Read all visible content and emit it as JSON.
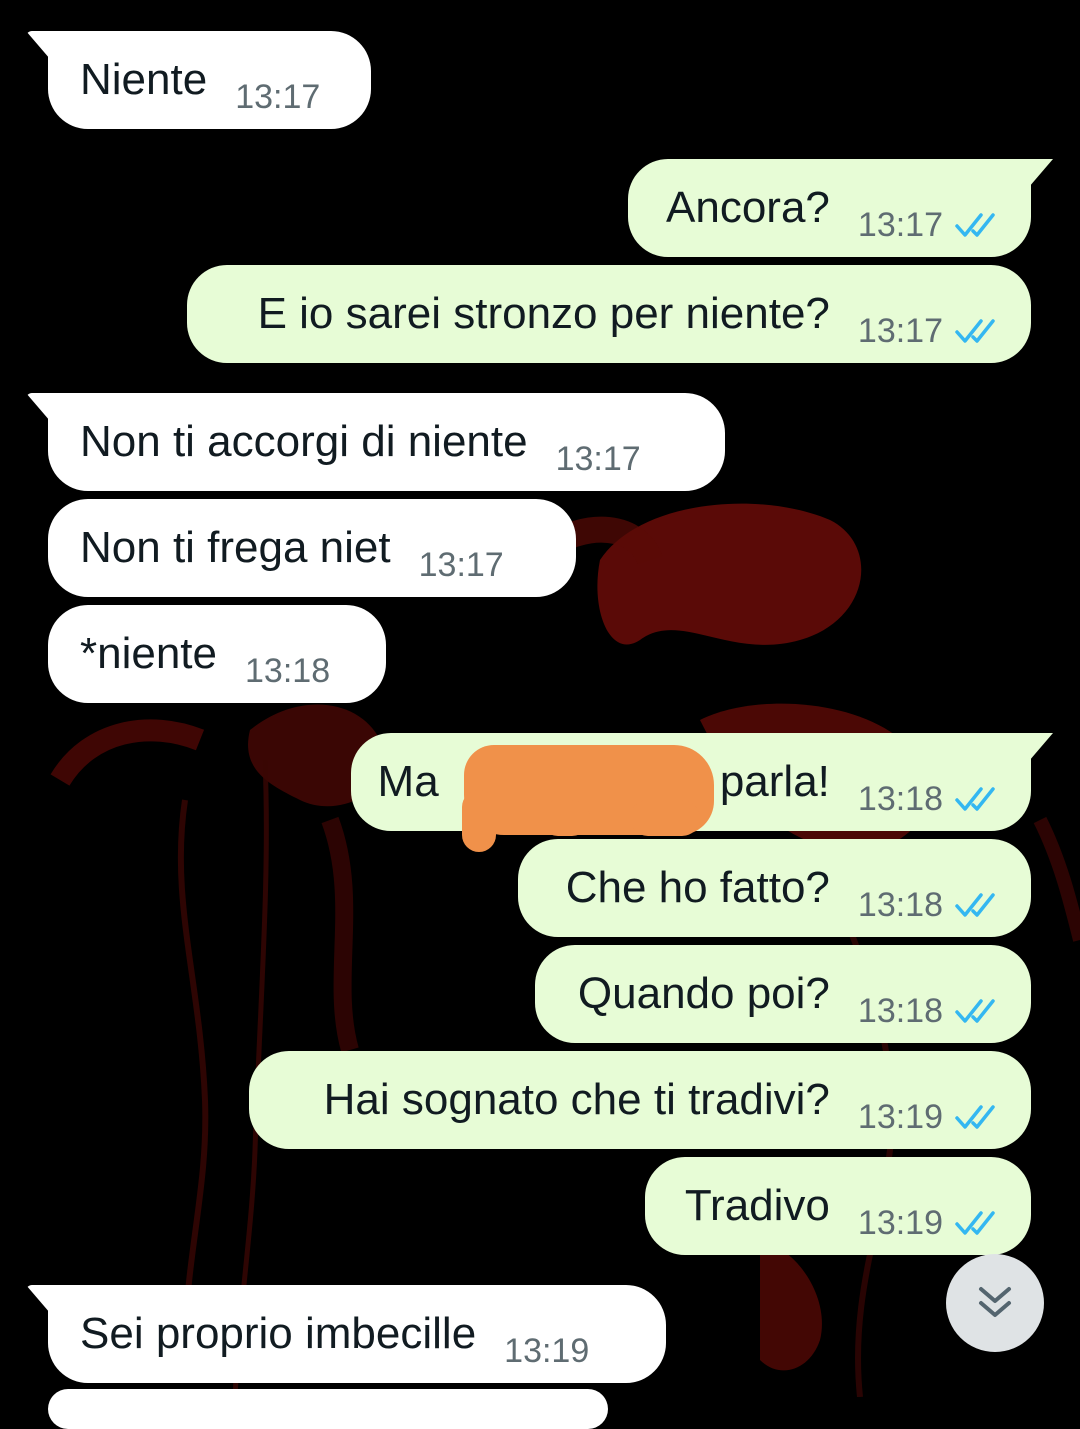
{
  "messages": [
    {
      "dir": "in",
      "text": "Niente",
      "time": "13:17"
    },
    {
      "dir": "out",
      "text": "Ancora?",
      "time": "13:17",
      "status": "double-check-read"
    },
    {
      "dir": "out",
      "text": "E io sarei stronzo per niente?",
      "time": "13:17",
      "status": "double-check-read"
    },
    {
      "dir": "in",
      "text": "Non ti accorgi di niente",
      "time": "13:17"
    },
    {
      "dir": "in",
      "text": "Non ti frega niet",
      "time": "13:17"
    },
    {
      "dir": "in",
      "text": "*niente",
      "time": "13:18"
    },
    {
      "dir": "out",
      "text": "Ma                       parla!",
      "time": "13:18",
      "status": "double-check-read",
      "redacted": true
    },
    {
      "dir": "out",
      "text": "Che ho fatto?",
      "time": "13:18",
      "status": "double-check-read"
    },
    {
      "dir": "out",
      "text": "Quando poi?",
      "time": "13:18",
      "status": "double-check-read"
    },
    {
      "dir": "out",
      "text": "Hai sognato che ti tradivi?",
      "time": "13:19",
      "status": "double-check-read"
    },
    {
      "dir": "out",
      "text": "Tradivo",
      "time": "13:19",
      "status": "double-check-read"
    },
    {
      "dir": "in",
      "text": "Sei proprio imbecille",
      "time": "13:19"
    }
  ],
  "scroll_button": {
    "icon": "double-chevron-down-icon"
  },
  "colors": {
    "incoming_bubble": "#ffffff",
    "outgoing_bubble": "#e7fcd6",
    "read_ticks": "#34b7f1",
    "top_accent": "#0e7a66",
    "redaction": "#f0914a"
  }
}
